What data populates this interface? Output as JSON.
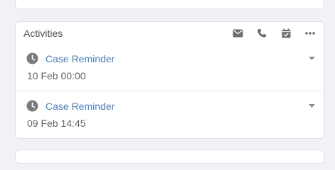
{
  "panel": {
    "title": "Activities",
    "toolbar_icons": [
      "email-icon",
      "phone-icon",
      "calendar-check-icon",
      "more-icon"
    ]
  },
  "activities": [
    {
      "title": "Case Reminder",
      "date": "10 Feb 00:00",
      "icon": "clock-icon"
    },
    {
      "title": "Case Reminder",
      "date": "09 Feb 14:45",
      "icon": "clock-icon"
    }
  ],
  "colors": {
    "link": "#4d7fb8",
    "icon": "#6b6f75",
    "text_muted": "#5f6368",
    "background": "#f1f2f5"
  }
}
